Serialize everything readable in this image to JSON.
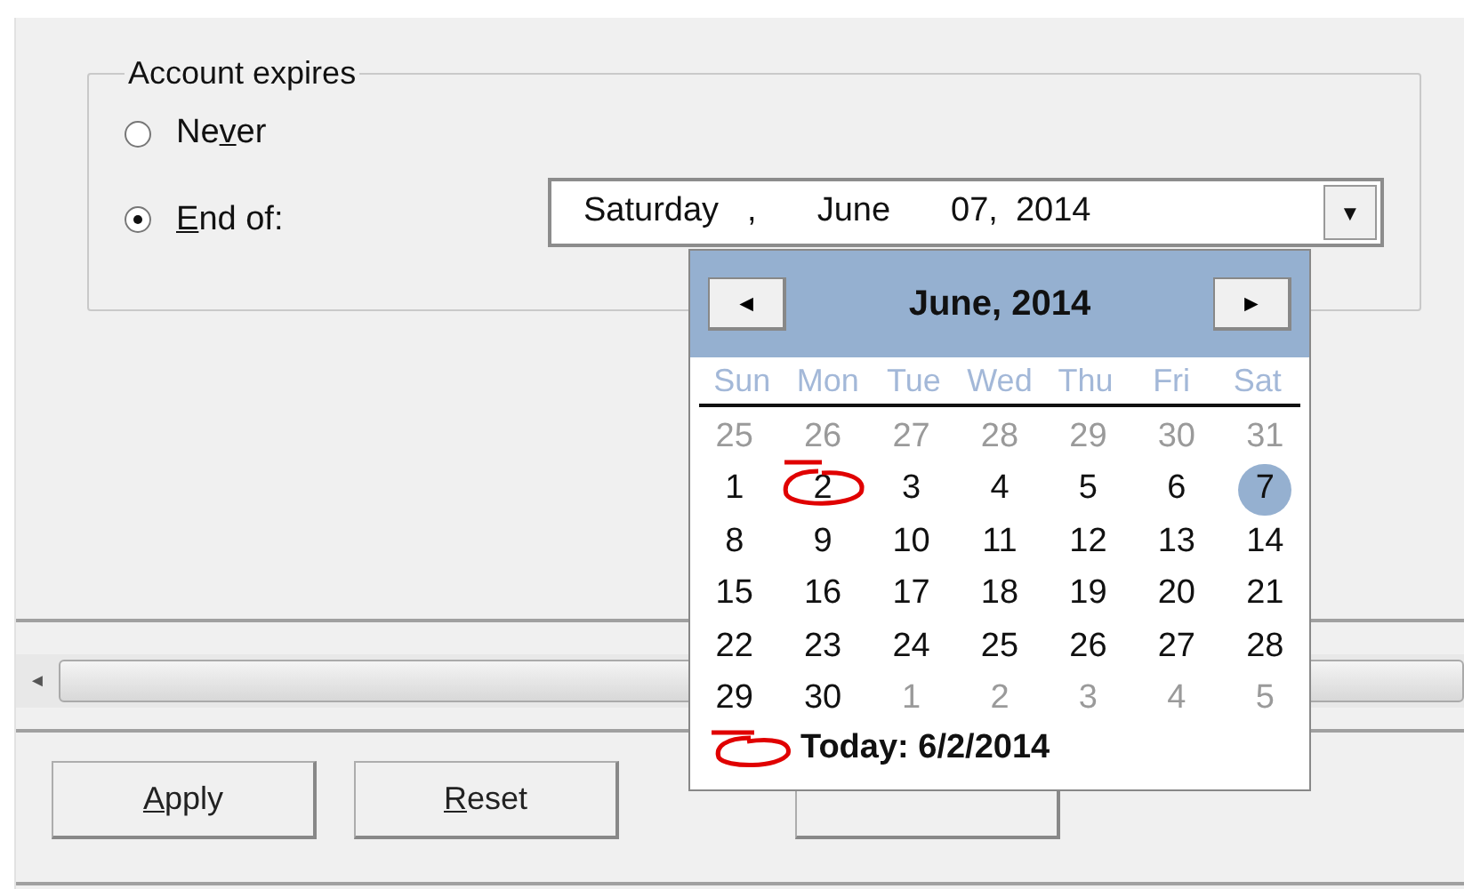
{
  "group": {
    "title": "Account expires"
  },
  "radios": [
    {
      "label_before": "Ne",
      "access_key": "v",
      "label_after": "er",
      "selected": false
    },
    {
      "access_key": "E",
      "label_after": "nd of:",
      "selected": true
    }
  ],
  "date_field": {
    "weekday": "Saturday",
    "separator": ",",
    "month": "June",
    "day": "07,",
    "year": "2014",
    "dropdown": "▼"
  },
  "calendar": {
    "prev": "◄",
    "title": "June, 2014",
    "next": "►",
    "weekdays": [
      "Sun",
      "Mon",
      "Tue",
      "Wed",
      "Thu",
      "Fri",
      "Sat"
    ],
    "weeks": [
      [
        {
          "day": "25",
          "kind": "other"
        },
        {
          "day": "26",
          "kind": "other"
        },
        {
          "day": "27",
          "kind": "other"
        },
        {
          "day": "28",
          "kind": "other"
        },
        {
          "day": "29",
          "kind": "other"
        },
        {
          "day": "30",
          "kind": "other"
        },
        {
          "day": "31",
          "kind": "other"
        }
      ],
      [
        {
          "day": "1",
          "kind": "current"
        },
        {
          "day": "2",
          "kind": "current",
          "circled": true
        },
        {
          "day": "3",
          "kind": "current"
        },
        {
          "day": "4",
          "kind": "current"
        },
        {
          "day": "5",
          "kind": "current"
        },
        {
          "day": "6",
          "kind": "current"
        },
        {
          "day": "7",
          "kind": "current",
          "selected": true
        }
      ],
      [
        {
          "day": "8",
          "kind": "current"
        },
        {
          "day": "9",
          "kind": "current"
        },
        {
          "day": "10",
          "kind": "current"
        },
        {
          "day": "11",
          "kind": "current"
        },
        {
          "day": "12",
          "kind": "current"
        },
        {
          "day": "13",
          "kind": "current"
        },
        {
          "day": "14",
          "kind": "current"
        }
      ],
      [
        {
          "day": "15",
          "kind": "current"
        },
        {
          "day": "16",
          "kind": "current"
        },
        {
          "day": "17",
          "kind": "current"
        },
        {
          "day": "18",
          "kind": "current"
        },
        {
          "day": "19",
          "kind": "current"
        },
        {
          "day": "20",
          "kind": "current"
        },
        {
          "day": "21",
          "kind": "current"
        }
      ],
      [
        {
          "day": "22",
          "kind": "current"
        },
        {
          "day": "23",
          "kind": "current"
        },
        {
          "day": "24",
          "kind": "current"
        },
        {
          "day": "25",
          "kind": "current"
        },
        {
          "day": "26",
          "kind": "current"
        },
        {
          "day": "27",
          "kind": "current"
        },
        {
          "day": "28",
          "kind": "current"
        }
      ],
      [
        {
          "day": "29",
          "kind": "current"
        },
        {
          "day": "30",
          "kind": "current"
        },
        {
          "day": "1",
          "kind": "other"
        },
        {
          "day": "2",
          "kind": "other"
        },
        {
          "day": "3",
          "kind": "other"
        },
        {
          "day": "4",
          "kind": "other"
        },
        {
          "day": "5",
          "kind": "other"
        }
      ]
    ],
    "today": {
      "text": "Today: 6/2/2014",
      "circled": true
    }
  },
  "scroll_bar": {
    "left_arrow": "◄"
  },
  "buttons": [
    {
      "kind": "labeled",
      "access_key": "A",
      "label_after": "pply"
    },
    {
      "kind": "labeled",
      "access_key": "R",
      "label_after": "eset"
    },
    {
      "kind": "covered"
    }
  ]
}
